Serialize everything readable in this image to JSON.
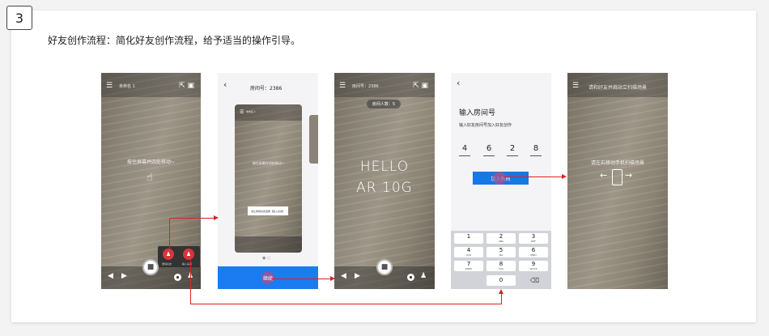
{
  "step": {
    "number": "3"
  },
  "description": "好友创作流程：简化好友创作流程，给予适当的操作引导。",
  "screens": {
    "s1": {
      "title": "未命名 1",
      "hint": "按住屏幕并四处移动~",
      "popup_left": "邀请好友",
      "popup_right": "输入房间"
    },
    "s2": {
      "room_label": "房间号：2386",
      "inner_title": "未命名 1",
      "inner_hint": "按住屏幕并四处移动~",
      "tooltip": "请让你的好友选择【加入好友】",
      "continue_label": "继续"
    },
    "s3": {
      "room_label": "房间号：2386",
      "count": "房间人数：5",
      "hello": "HELLO",
      "ar": "AR 10G"
    },
    "s4": {
      "title": "输入房间号",
      "subtitle": "输入好友房间号加入好友创作",
      "digits": [
        "4",
        "6",
        "2",
        "8"
      ],
      "join_label": "加入房间",
      "keys": [
        {
          "n": "1",
          "s": ""
        },
        {
          "n": "2",
          "s": "ABC"
        },
        {
          "n": "3",
          "s": "DEF"
        },
        {
          "n": "4",
          "s": "GHI"
        },
        {
          "n": "5",
          "s": "JKL"
        },
        {
          "n": "6",
          "s": "MNO"
        },
        {
          "n": "7",
          "s": "PQRS"
        },
        {
          "n": "8",
          "s": "TUV"
        },
        {
          "n": "9",
          "s": "WXYZ"
        },
        {
          "n": "0",
          "s": ""
        }
      ]
    },
    "s5": {
      "title": "请和好友并肩站立扫描场景",
      "hint": "请左右移动手机扫描场景"
    }
  },
  "colors": {
    "accent": "#1677e6",
    "arrow": "#dd2222",
    "popup_button": "#d9343b"
  },
  "icons": [
    "menu-icon",
    "share-icon",
    "save-icon",
    "back-arrow-icon",
    "forward-arrow-icon",
    "video-icon",
    "user-icon",
    "hand-icon",
    "phone-icon",
    "backspace-icon"
  ]
}
